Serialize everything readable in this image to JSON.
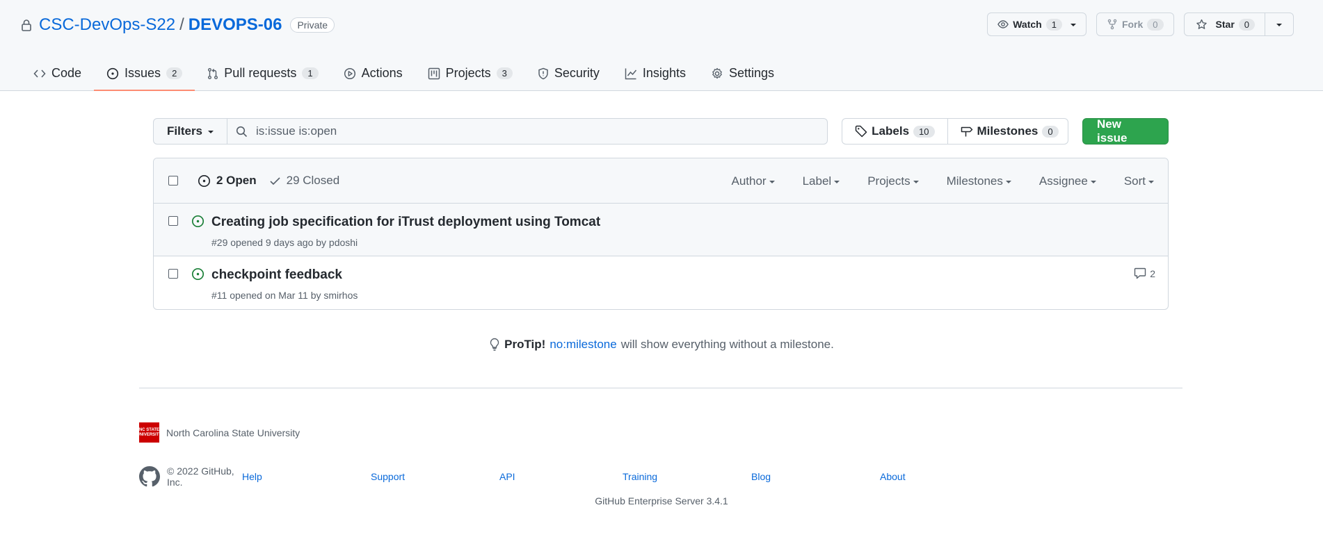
{
  "repo": {
    "owner": "CSC-DevOps-S22",
    "separator": "/",
    "name": "DEVOPS-06",
    "visibility": "Private"
  },
  "header_actions": {
    "watch": {
      "label": "Watch",
      "count": "1"
    },
    "fork": {
      "label": "Fork",
      "count": "0"
    },
    "star": {
      "label": "Star",
      "count": "0"
    }
  },
  "tabs": [
    {
      "label": "Code",
      "icon": "code-icon"
    },
    {
      "label": "Issues",
      "count": "2",
      "icon": "issue-opened-icon",
      "selected": true
    },
    {
      "label": "Pull requests",
      "count": "1",
      "icon": "git-pull-request-icon"
    },
    {
      "label": "Actions",
      "icon": "play-icon"
    },
    {
      "label": "Projects",
      "count": "3",
      "icon": "project-icon"
    },
    {
      "label": "Security",
      "icon": "shield-icon"
    },
    {
      "label": "Insights",
      "icon": "graph-icon"
    },
    {
      "label": "Settings",
      "icon": "gear-icon"
    }
  ],
  "toolbar": {
    "filters_label": "Filters",
    "search_value": "is:issue is:open",
    "labels": {
      "label": "Labels",
      "count": "10"
    },
    "milestones": {
      "label": "Milestones",
      "count": "0"
    },
    "new_issue_label": "New issue"
  },
  "issues_header": {
    "open_label": "2 Open",
    "closed_label": "29 Closed",
    "sorters": [
      "Author",
      "Label",
      "Projects",
      "Milestones",
      "Assignee",
      "Sort"
    ]
  },
  "issues": [
    {
      "title": "Creating job specification for iTrust deployment using Tomcat",
      "meta": "#29 opened 9 days ago by pdoshi",
      "comments": ""
    },
    {
      "title": "checkpoint feedback",
      "meta": "#11 opened on Mar 11 by smirhos",
      "comments": "2"
    }
  ],
  "protip": {
    "lead": "ProTip!",
    "link": "no:milestone",
    "rest": "will show everything without a milestone."
  },
  "footer": {
    "org_name": "North Carolina State University",
    "org_logo_text": "NC STATE UNIVERSITY",
    "copyright": "© 2022 GitHub, Inc.",
    "links": [
      "Help",
      "Support",
      "API",
      "Training",
      "Blog",
      "About"
    ],
    "version": "GitHub Enterprise Server 3.4.1"
  },
  "colors": {
    "link": "#0969da",
    "success": "#2da44e",
    "open_issue": "#1a7f37",
    "tab_underline": "#fd8c73"
  }
}
